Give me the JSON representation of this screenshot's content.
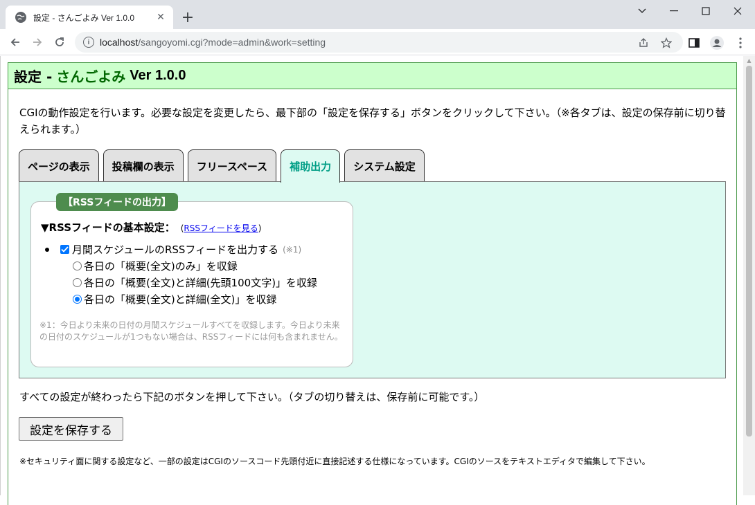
{
  "browser": {
    "tab_title": "設定 - さんごよみ Ver 1.0.0",
    "tab_close": "✕",
    "new_tab": "+",
    "url_host": "localhost",
    "url_rest": "/sangoyomi.cgi?mode=admin&work=setting"
  },
  "header": {
    "title": "設定 -",
    "app_name": "さんごよみ",
    "version": "Ver 1.0.0"
  },
  "intro": "CGIの動作設定を行います。必要な設定を変更したら、最下部の「設定を保存する」ボタンをクリックして下さい。（※各タブは、設定の保存前に切り替えられます。）",
  "tabs": [
    {
      "label": "ページの表示",
      "active": false
    },
    {
      "label": "投稿欄の表示",
      "active": false
    },
    {
      "label": "フリースペース",
      "active": false
    },
    {
      "label": "補助出力",
      "active": true
    },
    {
      "label": "システム設定",
      "active": false
    }
  ],
  "rss": {
    "legend": "【RSSフィードの出力】",
    "heading": "▼RSSフィードの基本設定：",
    "link_open": "(",
    "link_label": "RSSフィードを見る",
    "link_close": ")",
    "checkbox_label": "月間スケジュールのRSSフィードを出力する",
    "checkbox_checked": true,
    "checkbox_note": "(※1)",
    "radios": [
      {
        "label": "各日の「概要(全文)のみ」を収録",
        "checked": false
      },
      {
        "label": "各日の「概要(全文)と詳細(先頭100文字)」を収録",
        "checked": false
      },
      {
        "label": "各日の「概要(全文)と詳細(全文)」を収録",
        "checked": true
      }
    ],
    "footnote": "※1：今日より未来の日付の月間スケジュールすべてを収録します。今日より未来の日付のスケジュールが1つもない場合は、RSSフィードには何も含まれません。"
  },
  "after_text": "すべての設定が終わったら下記のボタンを押して下さい。（タブの切り替えは、保存前に可能です。）",
  "save_button": "設定を保存する",
  "bottom_note": "※セキュリティ面に関する設定など、一部の設定はCGIのソースコード先頭付近に直接記述する仕様になっています。CGIのソースをテキストエディタで編集して下さい。"
}
